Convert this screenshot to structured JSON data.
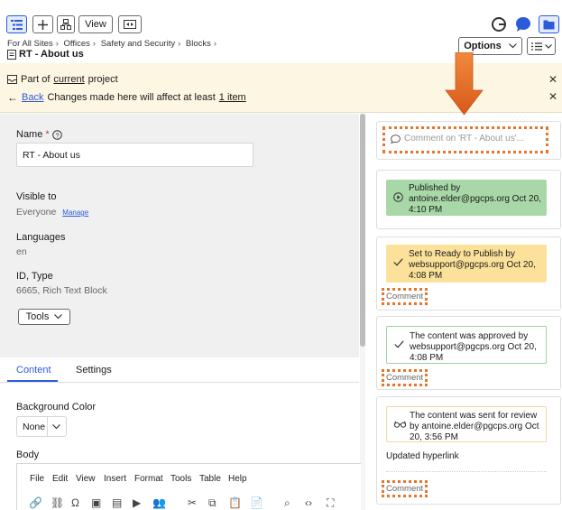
{
  "toolbar": {
    "view_label": "View",
    "accent_color": "#2b5bd7"
  },
  "breadcrumb": {
    "items": [
      "For All Sites",
      "Offices",
      "Safety and Security",
      "Blocks"
    ]
  },
  "page": {
    "title": "RT - About us",
    "options_label": "Options"
  },
  "banner": {
    "part_of_prefix": "Part of",
    "part_of_link": "current",
    "part_of_suffix": "project",
    "back_label": "Back",
    "changes_prefix": "Changes made here will affect at least",
    "changes_link": "1 item",
    "background": "#fdf6e2"
  },
  "form": {
    "name_label": "Name",
    "required_mark": "*",
    "name_value": "RT - About us",
    "visible_to_label": "Visible to",
    "visible_to_value": "Everyone",
    "manage_label": "Manage",
    "languages_label": "Languages",
    "languages_value": "en",
    "id_type_label": "ID, Type",
    "id_type_value": "6665, Rich Text Block",
    "tools_label": "Tools"
  },
  "tabs": [
    {
      "label": "Content",
      "active": true
    },
    {
      "label": "Settings",
      "active": false
    }
  ],
  "content": {
    "background_color_label": "Background Color",
    "background_color_value": "None",
    "body_label": "Body",
    "editor_menu": [
      "File",
      "Edit",
      "View",
      "Insert",
      "Format",
      "Tools",
      "Table",
      "Help"
    ]
  },
  "activity": {
    "comment_placeholder": "Comment on 'RT - About us'...",
    "comment_label": "Comment",
    "highlight_color": "#e8742a",
    "items": [
      {
        "text": "Published by antoine.elder@pgcps.org Oct 20, 4:10 PM",
        "style": "green"
      },
      {
        "text": "Set to Ready to Publish by websupport@pgcps.org Oct 20, 4:08 PM",
        "style": "yellow"
      },
      {
        "text": "The content was approved by websupport@pgcps.org Oct 20, 4:08 PM",
        "style": "white"
      },
      {
        "text": "The content was sent for review by antoine.elder@pgcps.org Oct 20, 3:56 PM",
        "style": "white-yellow",
        "note": "Updated hyperlink"
      }
    ]
  }
}
